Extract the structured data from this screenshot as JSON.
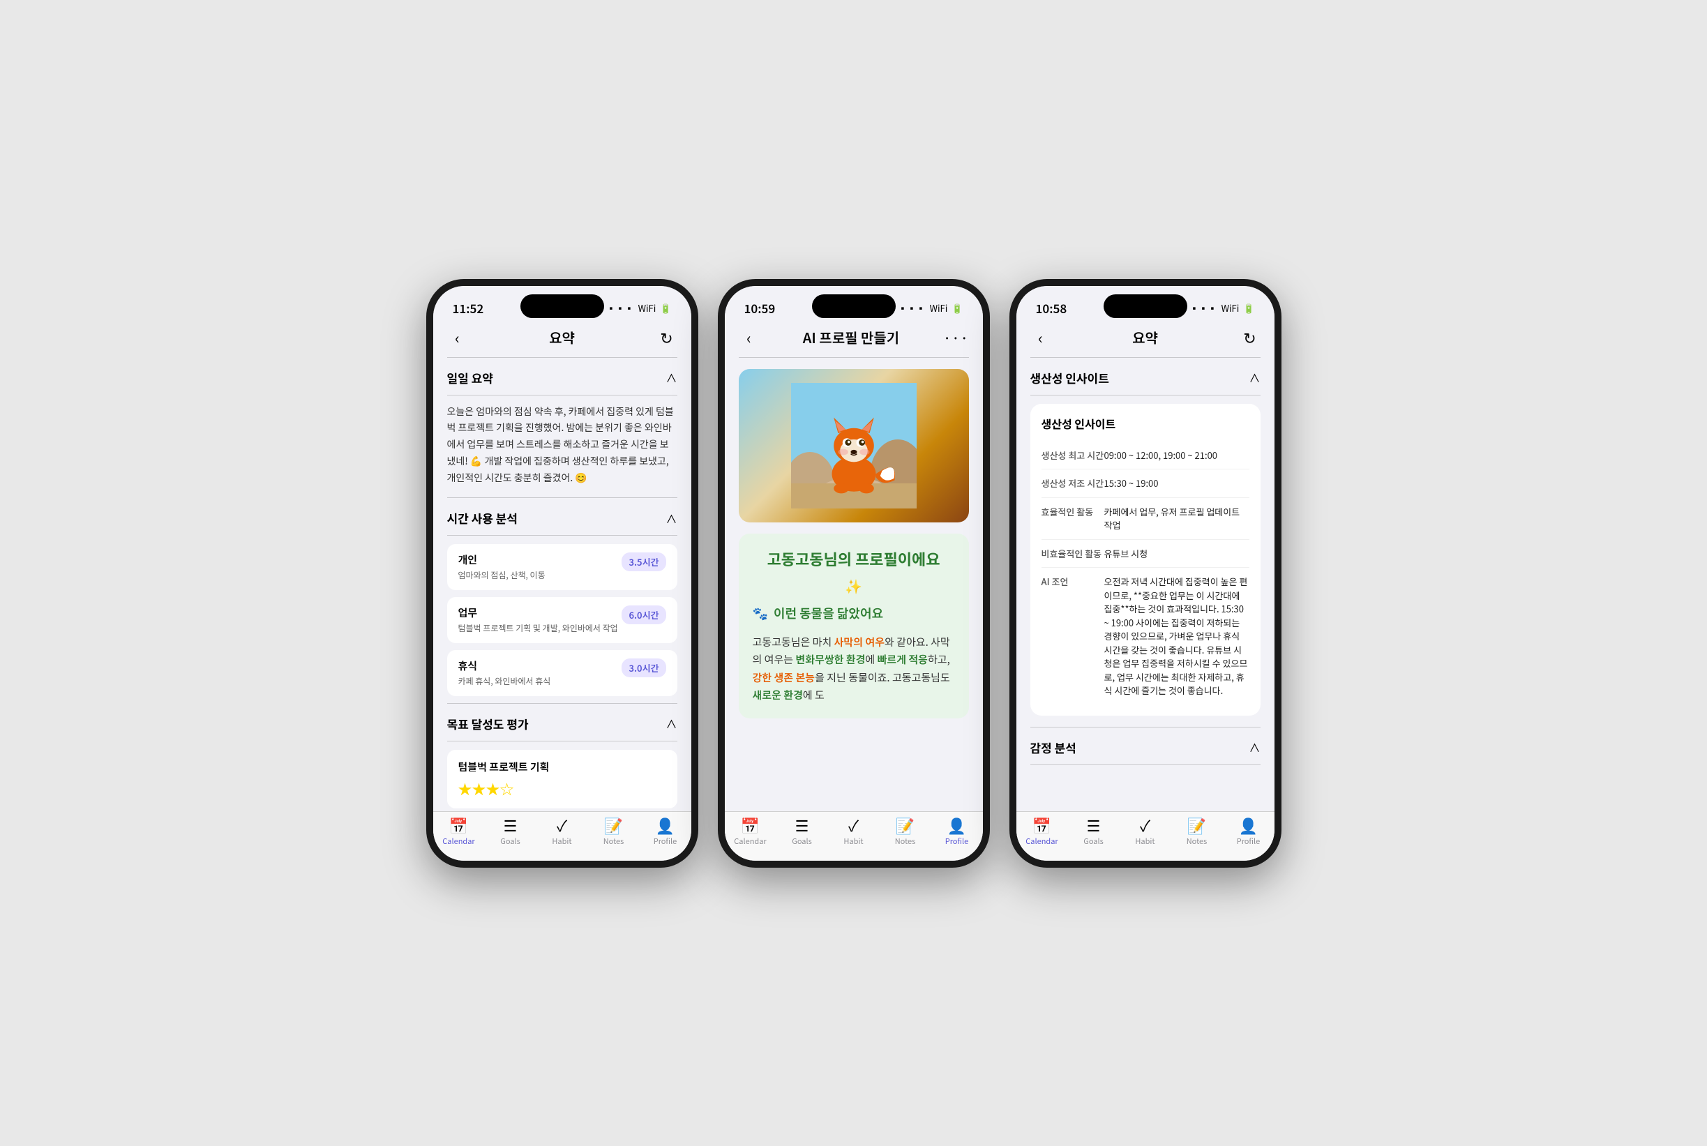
{
  "screens": [
    {
      "id": "screen1",
      "time": "11:52",
      "title": "요약",
      "nav_back": "‹",
      "nav_action": "↻",
      "sections": [
        {
          "id": "daily-summary",
          "title": "일일 요약",
          "content": "오늘은 엄마와의 점심 약속 후, 카페에서 집중력 있게 텀블벅 프로젝트 기획을 진행했어. 밤에는 분위기 좋은 와인바에서 업무를 보며 스트레스를 해소하고 즐거운 시간을 보냈네! 💪 개발 작업에 집중하며 생산적인 하루를 보냈고, 개인적인 시간도 충분히 즐겼어. 😊"
        },
        {
          "id": "time-analysis",
          "title": "시간 사용 분석",
          "items": [
            {
              "title": "개인",
              "desc": "엄마와의 점심, 산책, 이동",
              "badge": "3.5시간"
            },
            {
              "title": "업무",
              "desc": "텀블벅 프로젝트 기획 및 개발, 와인바에서 작업",
              "badge": "6.0시간"
            },
            {
              "title": "휴식",
              "desc": "카페 휴식, 와인바에서 휴식",
              "badge": "3.0시간"
            }
          ]
        },
        {
          "id": "goal-eval",
          "title": "목표 달성도 평가",
          "items": [
            {
              "title": "텀블벅 프로젝트 기획",
              "stars": 3.5
            }
          ]
        }
      ],
      "tabs": [
        {
          "icon": "📅",
          "label": "Calendar",
          "active": true
        },
        {
          "icon": "≡",
          "label": "Goals",
          "active": false
        },
        {
          "icon": "✓",
          "label": "Habit",
          "active": false
        },
        {
          "icon": "📄",
          "label": "Notes",
          "active": false
        },
        {
          "icon": "👤",
          "label": "Profile",
          "active": false
        }
      ]
    },
    {
      "id": "screen2",
      "time": "10:59",
      "title": "AI 프로필 만들기",
      "nav_back": "‹",
      "nav_action": "···",
      "profile": {
        "name_title": "고동고동님의 프로필이에요",
        "sparkle": "✨",
        "animal_icon": "🐾",
        "animal_title": "이런 동물을 닮았어요",
        "desc_part1": "고동고동님은 마치 ",
        "desc_highlight1": "사막의 여우",
        "desc_part2": "와 같아요.\n\n사막의 여우는 ",
        "desc_highlight2": "변화무쌍한 환경",
        "desc_part3": "에 ",
        "desc_highlight3": "빠르게 적응",
        "desc_part4": "하고, ",
        "desc_highlight4": "강한 생존 본능",
        "desc_part5": "을 지닌 동물이죠. 고동고동님도 ",
        "desc_highlight5": "새로운 환경",
        "desc_part6": "에 도"
      },
      "tabs": [
        {
          "icon": "📅",
          "label": "Calendar",
          "active": false
        },
        {
          "icon": "≡",
          "label": "Goals",
          "active": false
        },
        {
          "icon": "✓",
          "label": "Habit",
          "active": false
        },
        {
          "icon": "📄",
          "label": "Notes",
          "active": false
        },
        {
          "icon": "👤",
          "label": "Profile",
          "active": true
        }
      ]
    },
    {
      "id": "screen3",
      "time": "10:58",
      "title": "요약",
      "nav_back": "‹",
      "nav_action": "↻",
      "sections": [
        {
          "id": "productivity-insight",
          "title": "생산성 인사이트",
          "card_title": "생산성 인사이트",
          "rows": [
            {
              "label": "생산성 최고 시간",
              "value": "09:00 ~ 12:00, 19:00 ~ 21:00"
            },
            {
              "label": "생산성 저조 시간",
              "value": "15:30 ~ 19:00"
            },
            {
              "label": "효율적인 활동",
              "value": "카페에서 업무, 유저 프로필 업데이트 작업"
            },
            {
              "label": "비효율적인 활동",
              "value": "유튜브 시청"
            },
            {
              "label": "AI 조언",
              "value": "오전과 저녁 시간대에 집중력이 높은 편이므로, **중요한 업무는 이 시간대에 집중**하는 것이 효과적입니다. 15:30 ~ 19:00 사이에는 집중력이 저하되는 경향이 있으므로, 가벼운 업무나 휴식 시간을 갖는 것이 좋습니다. 유튜브 시청은 업무 집중력을 저하시킬 수 있으므로, 업무 시간에는 최대한 자제하고, 휴식 시간에 즐기는 것이 좋습니다."
            }
          ]
        },
        {
          "id": "emotion-analysis",
          "title": "감정 분석"
        }
      ],
      "tabs": [
        {
          "icon": "📅",
          "label": "Calendar",
          "active": true
        },
        {
          "icon": "≡",
          "label": "Goals",
          "active": false
        },
        {
          "icon": "✓",
          "label": "Habit",
          "active": false
        },
        {
          "icon": "📄",
          "label": "Notes",
          "active": false
        },
        {
          "icon": "👤",
          "label": "Profile",
          "active": false
        }
      ]
    }
  ]
}
